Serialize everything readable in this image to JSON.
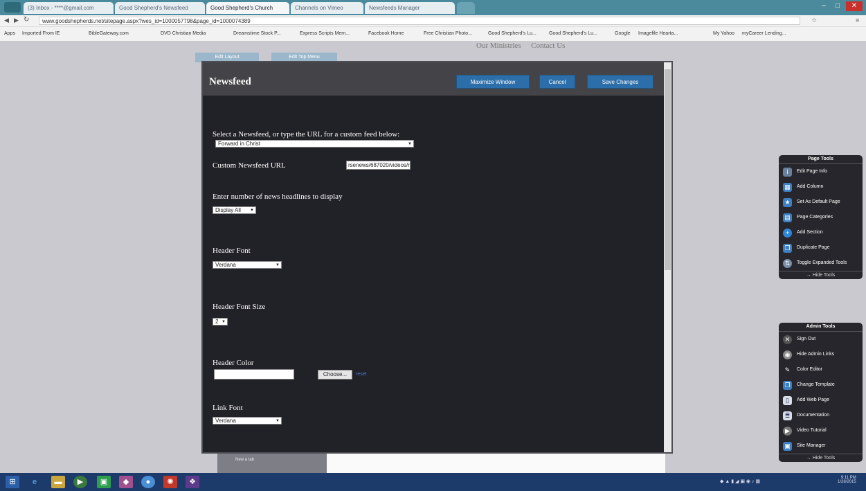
{
  "browser": {
    "tabs": [
      {
        "label": "(3) Inbox - ****@gmail.com",
        "active": false
      },
      {
        "label": "Good Shepherd's Newsfeed",
        "active": false
      },
      {
        "label": "Good Shepherd's Church",
        "active": true
      },
      {
        "label": "Channels on Vimeo",
        "active": false
      },
      {
        "label": "Newsfeeds Manager",
        "active": false
      }
    ],
    "address": "www.goodshepherds.net/sitepage.aspx?wes_id=1000057798&page_id=1000074389",
    "bookmarks": [
      "Apps",
      "Imported From IE",
      "BibleGateway.com",
      "DVD Christian Media",
      "Dreamstime Stock P...",
      "Express Scripts Mem...",
      "Facebook Home",
      "Free Christian Photo...",
      "Good Shepherd's Lu...",
      "Good Shepherd's Lu...",
      "Google",
      "Imagefile Hearta...",
      "My Yahoo",
      "myCareer Lending..."
    ]
  },
  "site": {
    "nav": [
      "Our Ministries",
      "Contact Us"
    ],
    "tabs": [
      "Edit Layout",
      "Edit Top Menu"
    ],
    "below_label": "New a tab"
  },
  "modal": {
    "title": "Newsfeed",
    "buttons": {
      "maximize": "Maximize Window",
      "cancel": "Cancel",
      "save": "Save Changes"
    },
    "select_feed_label": "Select a Newsfeed, or type the URL for a custom feed below:",
    "feed_value": "Forward in Christ",
    "custom_url_label": "Custom Newsfeed URL",
    "custom_url_value": "rsenews/687020/videos/rss",
    "headlines_label": "Enter number of news headlines to display",
    "headlines_value": "Display All",
    "header_font_label": "Header Font",
    "header_font_value": "Verdana",
    "header_font_size_label": "Header Font Size",
    "header_font_size_value": "2",
    "header_color_label": "Header Color",
    "header_color_value": "",
    "choose_label": "Choose...",
    "reset_label": "reset",
    "link_font_label": "Link Font",
    "link_font_value": "Verdana"
  },
  "page_tools": {
    "title": "Page Tools",
    "items": [
      {
        "label": "Edit Page Info",
        "icon": "info-icon"
      },
      {
        "label": "Add Column",
        "icon": "add-column-icon"
      },
      {
        "label": "Set As Default Page",
        "icon": "default-page-icon"
      },
      {
        "label": "Page Categories",
        "icon": "categories-icon"
      },
      {
        "label": "Add Section",
        "icon": "add-section-icon"
      },
      {
        "label": "Duplicate Page",
        "icon": "duplicate-icon"
      },
      {
        "label": "Toggle Expanded Tools",
        "icon": "toggle-icon"
      }
    ],
    "hide": "Hide Tools"
  },
  "admin_tools": {
    "title": "Admin Tools",
    "items": [
      {
        "label": "Sign Out",
        "icon": "sign-out-icon"
      },
      {
        "label": "Hide Admin Links",
        "icon": "hide-links-icon"
      },
      {
        "label": "Color Editor",
        "icon": "color-editor-icon"
      },
      {
        "label": "Change Template",
        "icon": "template-icon"
      },
      {
        "label": "Add Web Page",
        "icon": "add-page-icon"
      },
      {
        "label": "Documentation",
        "icon": "documentation-icon"
      },
      {
        "label": "Video Tutorial",
        "icon": "video-icon"
      },
      {
        "label": "Site Manager",
        "icon": "site-manager-icon"
      }
    ],
    "hide": "Hide Tools"
  },
  "taskbar": {
    "time": "9:11 PM",
    "date": "1/28/2015"
  }
}
